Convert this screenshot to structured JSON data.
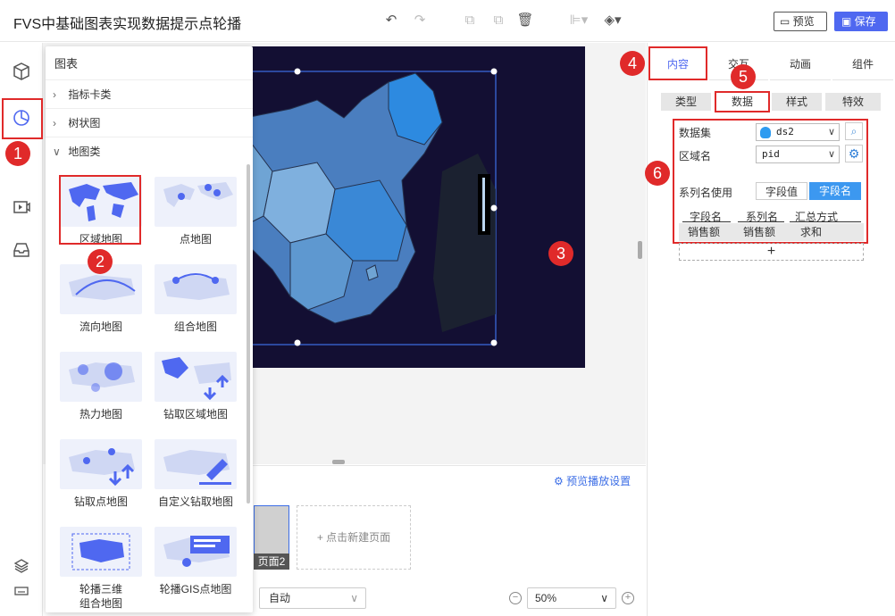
{
  "app": {
    "title": "FVS中基础图表实现数据提示点轮播"
  },
  "toolbar": {
    "preview_label": "预览",
    "save_label": "保存"
  },
  "chart_panel": {
    "title": "图表",
    "categories": [
      {
        "label": "指标卡类",
        "expanded": false
      },
      {
        "label": "树状图",
        "expanded": false
      },
      {
        "label": "地图类",
        "expanded": true
      }
    ],
    "items": [
      {
        "label": "区域地图"
      },
      {
        "label": "点地图"
      },
      {
        "label": "流向地图"
      },
      {
        "label": "组合地图"
      },
      {
        "label": "热力地图"
      },
      {
        "label": "钻取区域地图"
      },
      {
        "label": "钻取点地图"
      },
      {
        "label": "自定义钻取地图"
      },
      {
        "label": "轮播三维\n组合地图"
      },
      {
        "label": "轮播GIS点地图"
      }
    ]
  },
  "right_panel": {
    "tabs": [
      "内容",
      "交互",
      "动画",
      "组件"
    ],
    "subtabs": [
      "类型",
      "数据",
      "样式",
      "特效"
    ],
    "dataset_label": "数据集",
    "dataset_value": "ds2",
    "region_label": "区域名",
    "region_value": "pid",
    "series_name_label": "系列名使用",
    "series_options": [
      "字段值",
      "字段名"
    ],
    "series_selected": "字段名",
    "table_headers": [
      "字段名",
      "系列名",
      "汇总方式"
    ],
    "table_row": [
      "销售额",
      "销售额",
      "求和"
    ],
    "add_symbol": "+"
  },
  "bottom": {
    "preview_settings": "预览播放设置",
    "page_label": "页面2",
    "new_page": "+ 点击新建页面",
    "auto_value": "自动",
    "zoom_value": "50%"
  },
  "markers": [
    "1",
    "2",
    "3",
    "4",
    "5",
    "6"
  ],
  "colors": {
    "accent": "#4f68f0",
    "annotation_red": "#e02a2a",
    "canvas_bg": "#130f33"
  }
}
